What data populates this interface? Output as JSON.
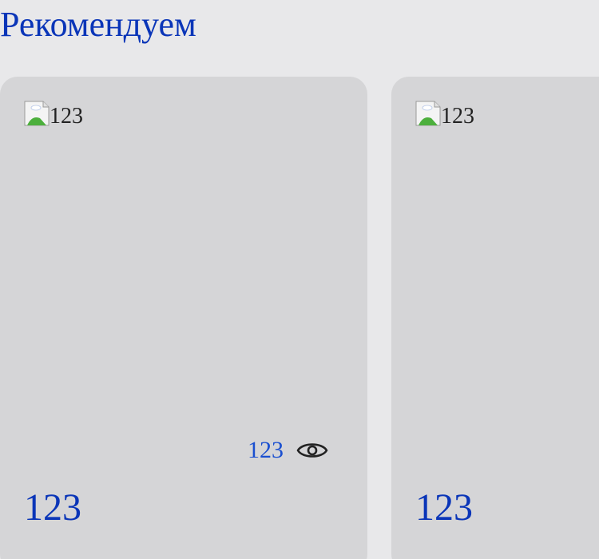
{
  "section": {
    "title": "Рекомендуем"
  },
  "cards": [
    {
      "image_alt": "123",
      "views": "123",
      "title": "123"
    },
    {
      "image_alt": "123",
      "title": "123"
    }
  ],
  "icons": {
    "broken_image": "broken-image-icon",
    "views": "eye-icon"
  },
  "colors": {
    "page_background": "#e8e8ea",
    "card_background": "#d5d5d7",
    "heading": "#0a35b8",
    "views_text": "#1a4fd0"
  }
}
